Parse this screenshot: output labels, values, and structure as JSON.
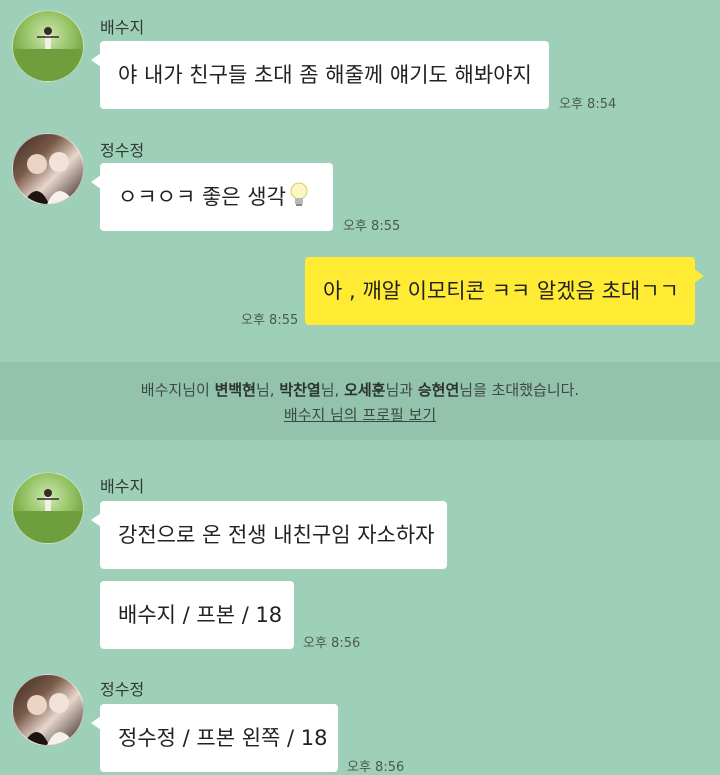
{
  "messages": [
    {
      "sender": "배수지",
      "text": "야 내가 친구들 초대 좀 해줄께 얘기도 해봐야지",
      "time": "오후 8:54"
    },
    {
      "sender": "정수정",
      "text": "ㅇㅋㅇㅋ 좋은 생각",
      "time": "오후 8:55"
    },
    {
      "text": "아 , 깨알 이모티콘 ㅋㅋ 알겠음 초대ㄱㄱ",
      "time": "오후 8:55"
    },
    {
      "sender": "배수지",
      "text": "강전으로 온 전생 내친구임 자소하자"
    },
    {
      "text": "배수지 / 프본 / 18",
      "time": "오후 8:56"
    },
    {
      "sender": "정수정",
      "text": "정수정 / 프본 왼쪽 / 18",
      "time": "오후 8:56"
    }
  ],
  "system": {
    "inviter": "배수지",
    "inviter_suffix": "님이 ",
    "invitees": [
      {
        "name": "변백현",
        "suffix": "님, "
      },
      {
        "name": "박찬열",
        "suffix": "님, "
      },
      {
        "name": "오세훈",
        "suffix": "님과 "
      },
      {
        "name": "승현연",
        "suffix": "님을 초대했습니다."
      }
    ],
    "profile_link": "배수지 님의 프로필 보기"
  },
  "icons": {
    "lightbulb": "lightbulb-icon"
  },
  "colors": {
    "background": "#9ecfb8",
    "outgoing_bubble": "#ffeb33",
    "incoming_bubble": "#ffffff"
  }
}
